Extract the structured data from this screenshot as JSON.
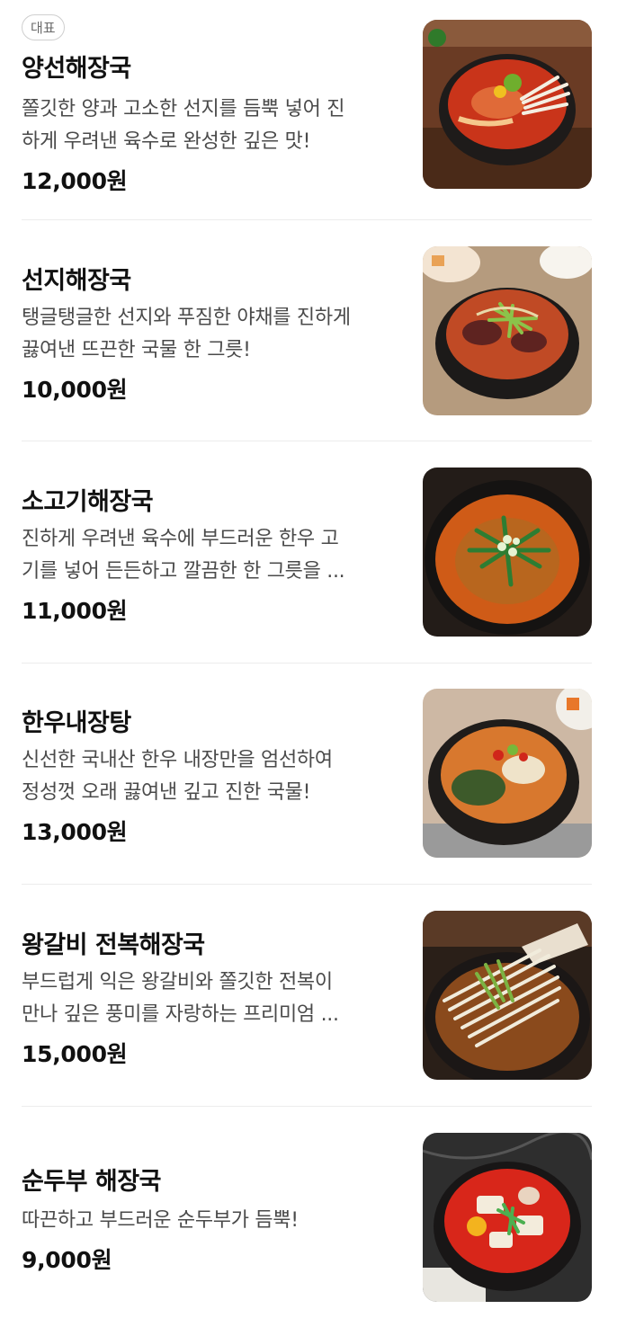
{
  "menu": {
    "items": [
      {
        "badge": "대표",
        "name": "양선해장국",
        "desc_line1": "쫄깃한 양과 고소한 선지를 듬뿍 넣어 진",
        "desc_line2": "하게 우려낸 육수로 완성한 깊은 맛!",
        "price": "12,000원",
        "image_icon": "hangover-soup-photo"
      },
      {
        "name": "선지해장국",
        "desc_line1": "탱글탱글한 선지와 푸짐한 야채를 진하게",
        "desc_line2": "끓여낸 뜨끈한 국물 한 그릇!",
        "price": "10,000원",
        "image_icon": "hangover-soup-photo"
      },
      {
        "name": "소고기해장국",
        "desc_line1": "진하게 우려낸 육수에 부드러운 한우 고",
        "desc_line2": "기를 넣어 든든하고 깔끔한 한 그릇을 ...",
        "price": "11,000원",
        "image_icon": "hangover-soup-photo"
      },
      {
        "name": "한우내장탕",
        "desc_line1": "신선한 국내산 한우 내장만을 엄선하여",
        "desc_line2": "정성껏 오래 끓여낸 깊고 진한 국물!",
        "price": "13,000원",
        "image_icon": "hangover-soup-photo"
      },
      {
        "name": "왕갈비 전복해장국",
        "desc_line1": "부드럽게 익은 왕갈비와 쫄깃한 전복이",
        "desc_line2": "만나 깊은 풍미를 자랑하는 프리미엄 ...",
        "price": "15,000원",
        "image_icon": "hangover-soup-photo"
      },
      {
        "name": "순두부 해장국",
        "desc_line1": "따끈하고 부드러운 순두부가 듬뿍!",
        "price": "9,000원",
        "image_icon": "hangover-soup-photo"
      }
    ]
  },
  "colors": {
    "text": "#111111",
    "description": "#4a4a4a",
    "divider": "#ececec",
    "badge_border": "#cfcfcf"
  }
}
